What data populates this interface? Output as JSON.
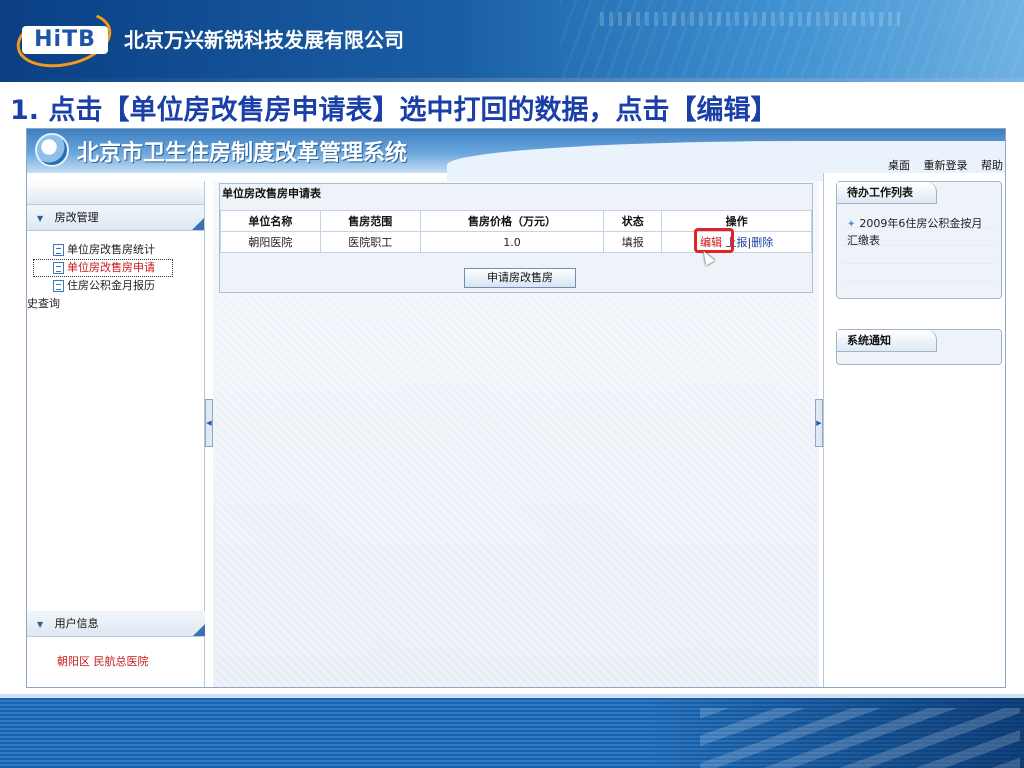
{
  "slide": {
    "company": "北京万兴新锐科技发展有限公司",
    "logo_text": "HiTB",
    "heading": "1. 点击【单位房改售房申请表】选中打回的数据，点击【编辑】"
  },
  "app": {
    "title": "北京市卫生住房制度改革管理系统",
    "top_links": [
      "桌面",
      "重新登录",
      "帮助"
    ],
    "sidebar": {
      "section_main": "房改管理",
      "items": [
        {
          "label": "单位房改售房统计"
        },
        {
          "label": "单位房改售房申请"
        },
        {
          "label_line1": "住房公积金月报历",
          "label_line2": "史查询"
        }
      ],
      "section_user": "用户信息",
      "user_text": "朝阳区  民航总医院"
    },
    "form": {
      "title": "单位房改售房申请表",
      "columns": [
        "单位名称",
        "售房范围",
        "售房价格（万元）",
        "状态",
        "操作"
      ],
      "rows": [
        {
          "unit": "朝阳医院",
          "scope": "医院职工",
          "price": "1.0",
          "status": "填报",
          "op_edit": "编辑",
          "op_report": "上报",
          "op_delete": "删除"
        }
      ],
      "apply_button": "申请房改售房"
    },
    "right": {
      "todo_title": "待办工作列表",
      "todo_item": "2009年6住房公积金按月汇缴表",
      "notice_title": "系统通知"
    }
  },
  "colors": {
    "heading": "#1a3fa8",
    "highlight_red": "#e32222",
    "active_item": "#c8181a",
    "banner": "#1a5fa6"
  },
  "icons": [
    "emblem-icon",
    "doc-icon",
    "triangle-down-icon",
    "star-icon",
    "cursor-icon",
    "collapse-arrow-icon"
  ]
}
